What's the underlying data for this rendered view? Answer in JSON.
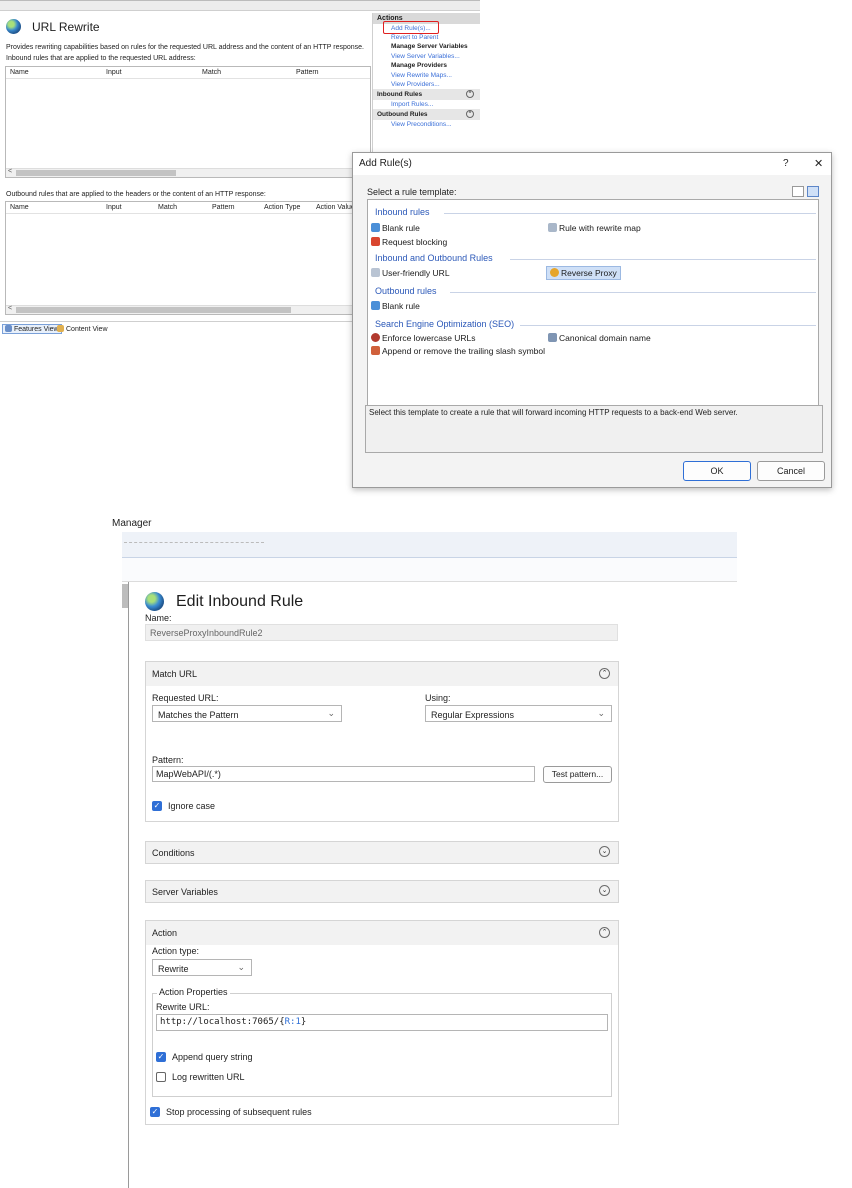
{
  "url_rewrite": {
    "title": "URL Rewrite",
    "description": "Provides rewriting capabilities based on rules for the requested URL address and the content of an HTTP response.",
    "inbound_caption": "Inbound rules that are applied to the requested URL address:",
    "inbound_columns": [
      "Name",
      "Input",
      "Match",
      "Pattern"
    ],
    "outbound_caption": "Outbound rules that are applied to the headers or the content of an HTTP response:",
    "outbound_columns": [
      "Name",
      "Input",
      "Match",
      "Pattern",
      "Action Type",
      "Action Value"
    ],
    "view_tabs": {
      "features": "Features View",
      "content": "Content View"
    },
    "actions": {
      "header": "Actions",
      "add_rules": "Add Rule(s)...",
      "revert": "Revert to Parent",
      "manage_server_vars": "Manage Server Variables",
      "view_server_vars": "View Server Variables...",
      "manage_providers": "Manage Providers",
      "view_rewrite_maps": "View Rewrite Maps...",
      "view_providers": "View Providers...",
      "inbound_rules": "Inbound Rules",
      "import_rules": "Import Rules...",
      "outbound_rules": "Outbound Rules",
      "view_preconditions": "View Preconditions..."
    },
    "highlight_color": "#e02020"
  },
  "add_rules_dialog": {
    "title": "Add Rule(s)",
    "help": "?",
    "close": "✕",
    "select_label": "Select a rule template:",
    "groups": {
      "inbound": "Inbound rules",
      "inout": "Inbound and Outbound Rules",
      "outbound": "Outbound rules",
      "seo": "Search Engine Optimization (SEO)"
    },
    "items": {
      "blank_rule": "Blank rule",
      "rewrite_map": "Rule with rewrite map",
      "request_blocking": "Request blocking",
      "user_friendly": "User-friendly URL",
      "reverse_proxy": "Reverse Proxy",
      "outbound_blank": "Blank rule",
      "lowercase": "Enforce lowercase URLs",
      "canonical": "Canonical domain name",
      "trailing_slash": "Append or remove the trailing slash symbol"
    },
    "description": "Select this template to create a rule that will forward incoming HTTP requests to a back-end Web server.",
    "ok": "OK",
    "cancel": "Cancel"
  },
  "edit_rule": {
    "window_title": "Manager",
    "title": "Edit Inbound Rule",
    "name_label": "Name:",
    "name_value": "ReverseProxyInboundRule2",
    "match_url": {
      "header": "Match URL",
      "requested_label": "Requested URL:",
      "requested_value": "Matches the Pattern",
      "using_label": "Using:",
      "using_value": "Regular Expressions",
      "pattern_label": "Pattern:",
      "pattern_value": "MapWebAPI/(.*)",
      "test_button": "Test pattern...",
      "ignore_case": "Ignore case"
    },
    "conditions": "Conditions",
    "server_variables": "Server Variables",
    "action": {
      "header": "Action",
      "type_label": "Action type:",
      "type_value": "Rewrite",
      "properties": "Action Properties",
      "rewrite_label": "Rewrite URL:",
      "rewrite_prefix": "http://localhost:7065/{",
      "rewrite_var": "R:1",
      "rewrite_suffix": "}",
      "append_query": "Append query string",
      "log_rewritten": "Log rewritten URL",
      "stop_processing": "Stop processing of subsequent rules"
    }
  }
}
